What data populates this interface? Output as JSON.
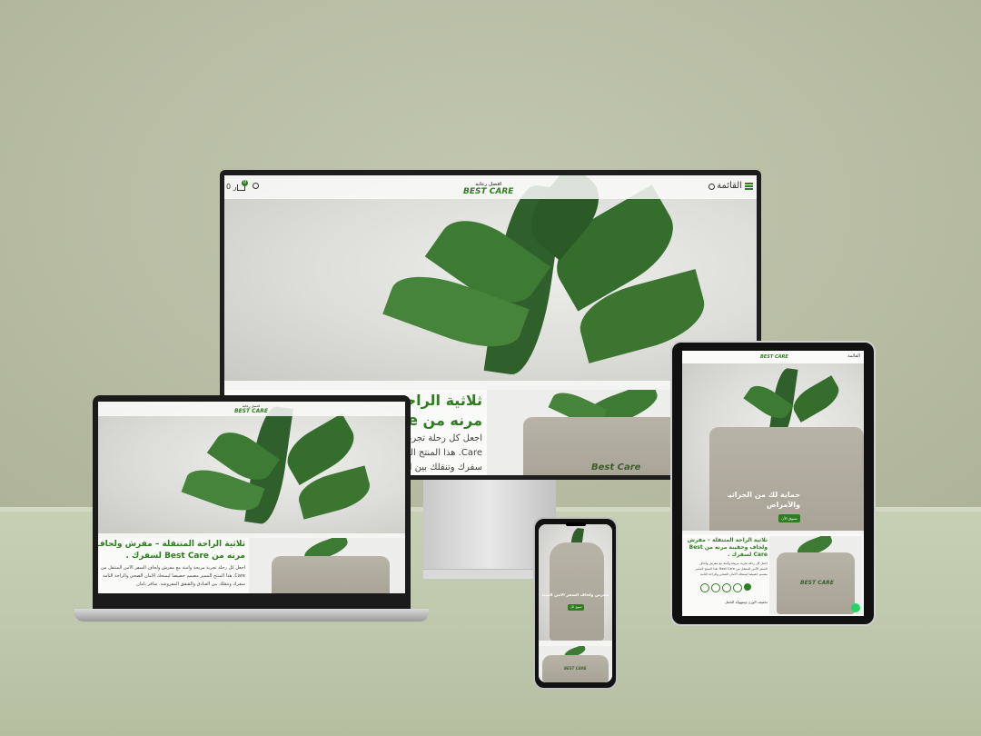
{
  "desktop": {
    "nav": {
      "menu_label": "القائمة",
      "logo_main": "BEST CARE",
      "logo_sub": "افضل رعاية",
      "cart_count": "0",
      "cart_badge": "0",
      "currency": "ر"
    },
    "product": {
      "title_line1": "ثلاثية الراحة",
      "title_line2": "مرنه من Best Care",
      "desc_line1": "اجعل كل رحلة تجربة م",
      "desc_line2": "Care. هذا المنتج الم",
      "desc_line3": "سفرك وتنقلك بين ال"
    },
    "bag_print": "Best Care"
  },
  "laptop": {
    "logo_main": "BEST CARE",
    "logo_sub": "افضل رعاية",
    "title_line1": "ثلاثية الراحة المتنقلة – مفرش ولحاف وحقيبة",
    "title_line2": "مرنه من Best Care لسفرك .",
    "desc_line1": "اجعل كل رحلة تجربة مريحة وآمنة مع مفرش ولحاف السفر الآمن المتنقل من",
    "desc_line2": "Care. هذا المنتج المميز مصمم خصيصاً ليمنحك الأمان الصحي والراحة التامة",
    "desc_line3": "سفرك وتنقلك بين الفنادق والشقق المفروشة. سافر بأمان"
  },
  "tablet": {
    "menu_label": "القائمة",
    "logo_main": "BEST CARE",
    "hero_text_line1": "حماية لك من الجراثيم",
    "hero_text_line2": "والأمراض",
    "hero_button": "تسوق الآن",
    "title_line1": "ثلاثية الراحة المتنقلة – مفرش",
    "title_line2": "ولحاف وحقيبة مرنه من Best",
    "title_line3": "Care لسفرك .",
    "desc_line1": "اجعل كل رحلة تجربة مريحة وآمنة مع مفرش ولحاف",
    "desc_line2": "السفر الآمن المتنقل من Best Care. هذا المنتج المميز",
    "desc_line3": "مصمم خصيصاً ليمنحك الأمان الصحي والراحة التامة",
    "footer_text": "تخفيف الوزن وسهولة الحمل",
    "bag_print": "BEST CARE"
  },
  "phone": {
    "hero_text": "مفرش ولحاف السفر الامن المتنقل",
    "hero_button": "تسوق الآن",
    "bag_print": "BEST CARE"
  },
  "colors": {
    "brand_green": "#2e7d1f",
    "whatsapp": "#25d366"
  }
}
